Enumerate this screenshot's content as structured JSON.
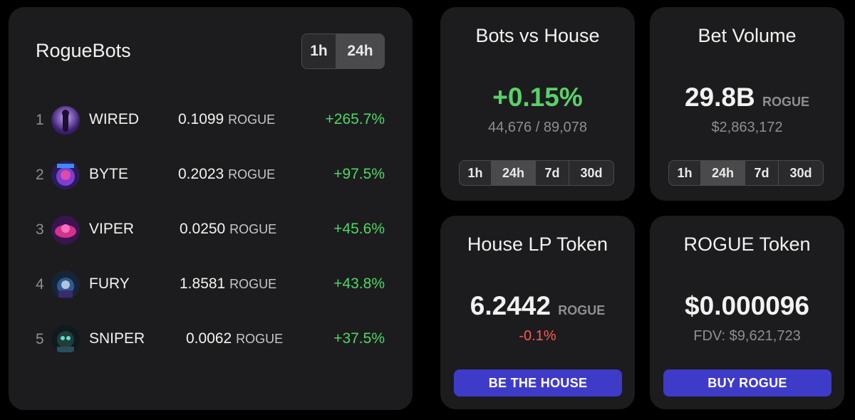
{
  "leaderboard": {
    "title": "RogueBots",
    "periods": [
      "1h",
      "24h"
    ],
    "active_period": "24h",
    "rows": [
      {
        "rank": "1",
        "name": "WIRED",
        "price": "0.1099",
        "unit": "ROGUE",
        "change": "+265.7%"
      },
      {
        "rank": "2",
        "name": "BYTE",
        "price": "0.2023",
        "unit": "ROGUE",
        "change": "+97.5%"
      },
      {
        "rank": "3",
        "name": "VIPER",
        "price": "0.0250",
        "unit": "ROGUE",
        "change": "+45.6%"
      },
      {
        "rank": "4",
        "name": "FURY",
        "price": "1.8581",
        "unit": "ROGUE",
        "change": "+43.8%"
      },
      {
        "rank": "5",
        "name": "SNIPER",
        "price": "0.0062",
        "unit": "ROGUE",
        "change": "+37.5%"
      }
    ]
  },
  "bots_vs_house": {
    "title": "Bots vs House",
    "value": "+0.15%",
    "sub": "44,676 / 89,078",
    "periods": [
      "1h",
      "24h",
      "7d",
      "30d"
    ],
    "active_period": "24h"
  },
  "bet_volume": {
    "title": "Bet Volume",
    "value": "29.8B",
    "unit": "ROGUE",
    "sub": "$2,863,172",
    "periods": [
      "1h",
      "24h",
      "7d",
      "30d"
    ],
    "active_period": "24h"
  },
  "house_lp": {
    "title": "House LP Token",
    "value": "6.2442",
    "unit": "ROGUE",
    "change": "-0.1%",
    "button": "BE THE HOUSE"
  },
  "rogue_token": {
    "title": "ROGUE Token",
    "value": "$0.000096",
    "sub": "FDV: $9,621,723",
    "button": "BUY ROGUE"
  },
  "colors": {
    "positive": "#5ad16a",
    "negative": "#ff5b4f",
    "button": "#3f3bc9",
    "card": "#1c1c1e"
  }
}
